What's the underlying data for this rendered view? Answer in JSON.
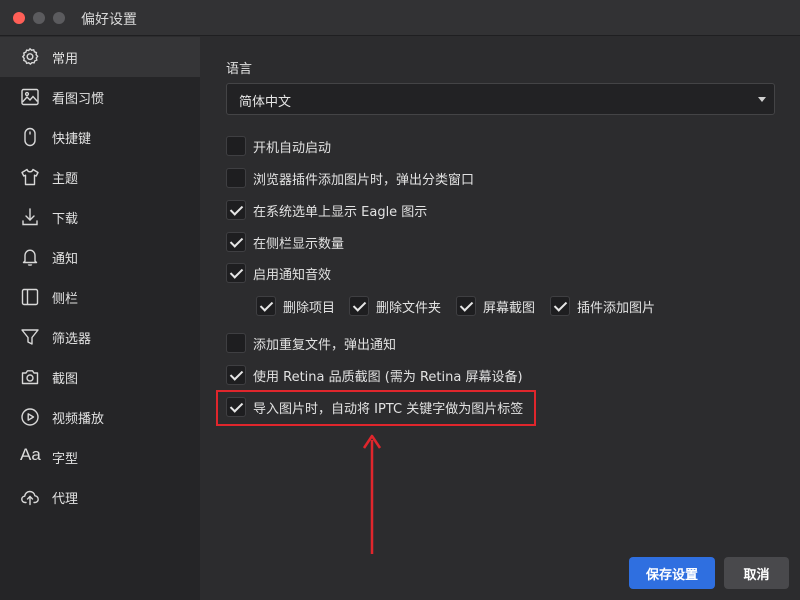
{
  "window": {
    "title": "偏好设置"
  },
  "sidebar": {
    "items": [
      {
        "label": "常用",
        "icon": "gear-icon",
        "active": true
      },
      {
        "label": "看图习惯",
        "icon": "image-icon"
      },
      {
        "label": "快捷键",
        "icon": "mouse-icon"
      },
      {
        "label": "主题",
        "icon": "shirt-icon"
      },
      {
        "label": "下载",
        "icon": "download-icon"
      },
      {
        "label": "通知",
        "icon": "bell-icon"
      },
      {
        "label": "侧栏",
        "icon": "sidebar-icon"
      },
      {
        "label": "筛选器",
        "icon": "filter-icon"
      },
      {
        "label": "截图",
        "icon": "camera-icon"
      },
      {
        "label": "视频播放",
        "icon": "play-icon"
      },
      {
        "label": "字型",
        "icon": "font-icon",
        "icon_text": "Aa"
      },
      {
        "label": "代理",
        "icon": "cloud-upload-icon"
      }
    ]
  },
  "general": {
    "language_label": "语言",
    "language_value": "简体中文",
    "options": [
      {
        "label": "开机自动启动",
        "checked": false
      },
      {
        "label": "浏览器插件添加图片时，弹出分类窗口",
        "checked": false
      },
      {
        "label": "在系统选单上显示 Eagle 图示",
        "checked": true
      },
      {
        "label": "在侧栏显示数量",
        "checked": true
      },
      {
        "label": "启用通知音效",
        "checked": true
      }
    ],
    "sound_options": [
      {
        "label": "删除项目",
        "checked": true
      },
      {
        "label": "删除文件夹",
        "checked": true
      },
      {
        "label": "屏幕截图",
        "checked": true
      },
      {
        "label": "插件添加图片",
        "checked": true
      }
    ],
    "more_options": [
      {
        "label": "添加重复文件，弹出通知",
        "checked": false
      },
      {
        "label": "使用 Retina 品质截图 (需为 Retina 屏幕设备)",
        "checked": true
      },
      {
        "label": "导入图片时，自动将 IPTC 关键字做为图片标签",
        "checked": true
      }
    ]
  },
  "footer": {
    "save_label": "保存设置",
    "cancel_label": "取消"
  },
  "colors": {
    "accent": "#2f6fe0",
    "highlight": "#e0262c",
    "close": "#ff5f57"
  }
}
